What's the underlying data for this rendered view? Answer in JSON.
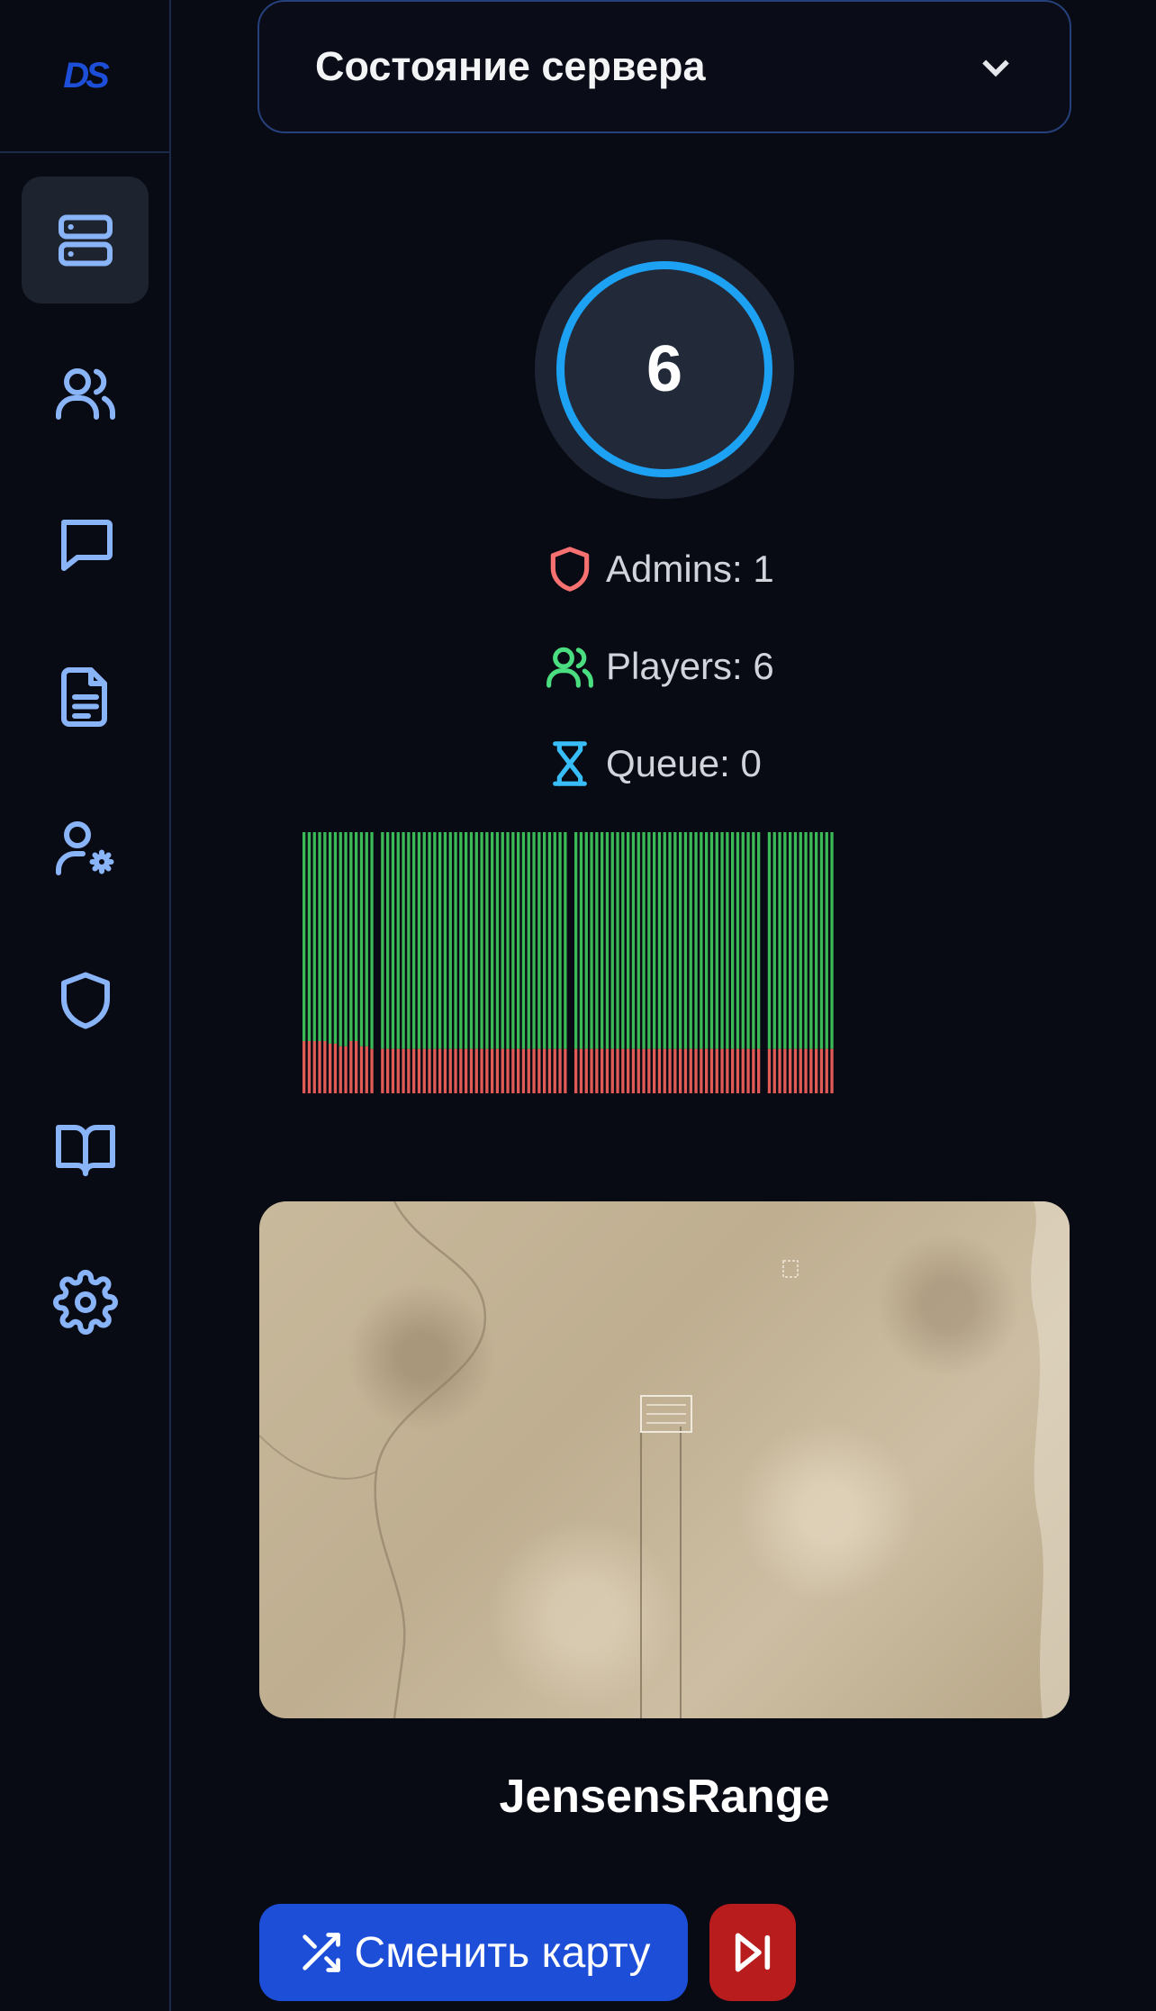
{
  "logo": {
    "text": "DS"
  },
  "sidebar": {
    "items": [
      {
        "name": "servers",
        "icon": "server-icon",
        "active": true
      },
      {
        "name": "players",
        "icon": "users-icon"
      },
      {
        "name": "chat",
        "icon": "chat-icon"
      },
      {
        "name": "logs",
        "icon": "document-icon"
      },
      {
        "name": "user-settings",
        "icon": "user-gear-icon"
      },
      {
        "name": "admins",
        "icon": "shield-icon"
      },
      {
        "name": "rules",
        "icon": "book-icon"
      },
      {
        "name": "settings",
        "icon": "gear-icon"
      }
    ]
  },
  "header": {
    "selector_label": "Состояние сервера",
    "icon": "chevron-down-icon"
  },
  "server": {
    "player_count": "6",
    "admins": "Admins: 1",
    "players": "Players: 6",
    "queue": "Queue: 0"
  },
  "colors": {
    "admins": "#f87171",
    "players": "#4ade80",
    "queue": "#38bdf8",
    "accent": "#1da1f2"
  },
  "chart_data": {
    "type": "bar",
    "stacked": true,
    "series": [
      {
        "color": "#e05a56",
        "segments": [
          {
            "count": 5,
            "value": 20
          },
          {
            "count": 2,
            "value": 19
          },
          {
            "count": 2,
            "value": 18
          },
          {
            "count": 2,
            "value": 20
          },
          {
            "count": 2,
            "value": 18
          },
          {
            "count": 86,
            "value": 17
          }
        ]
      },
      {
        "color": "#3cb957",
        "fill_to": 100
      }
    ],
    "gaps_after": [
      13,
      49,
      85
    ],
    "ylim": [
      0,
      100
    ]
  },
  "map": {
    "name": "JensensRange"
  },
  "actions": {
    "change_map": "Сменить карту",
    "change_map_icon": "shuffle-icon",
    "skip_icon": "skip-forward-icon"
  }
}
